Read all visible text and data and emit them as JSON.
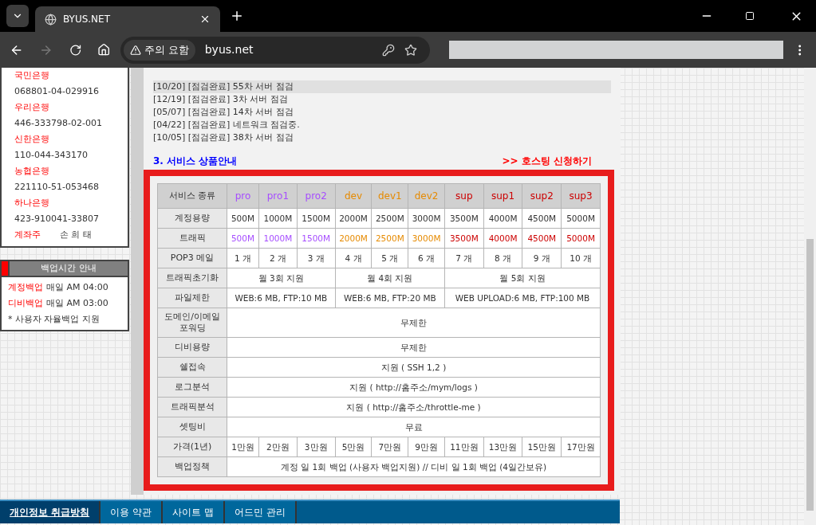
{
  "browser": {
    "tab_title": "BYUS.NET",
    "warning": "주의 요함",
    "url": "byus.net"
  },
  "sidebar": {
    "banks": [
      {
        "name": "국민은행",
        "account": "068801-04-029916"
      },
      {
        "name": "우리은행",
        "account": "446-333798-02-001"
      },
      {
        "name": "신한은행",
        "account": "110-044-343170"
      },
      {
        "name": "농협은행",
        "account": "221110-51-053468"
      },
      {
        "name": "하나은행",
        "account": "423-910041-33807"
      }
    ],
    "holder": {
      "label": "계좌주",
      "value": "손 희 태"
    },
    "backup": {
      "title": "백업시간 안내",
      "items": [
        {
          "label": "계정백업",
          "text": "매일 AM 04:00"
        },
        {
          "label": "디비백업",
          "text": "매일 AM 03:00"
        }
      ],
      "note": "* 사용자 자율백업 지원"
    }
  },
  "notices": [
    {
      "text": "[10/20] [점검완료] 55차 서버 점검",
      "selected": true
    },
    {
      "text": "[12/19] [점검완료] 3차 서버 점검",
      "selected": false
    },
    {
      "text": "[05/07] [점검완료] 14차 서버 점검",
      "selected": false
    },
    {
      "text": "[04/22] [점검완료] 네트워크 점검중.",
      "selected": false
    },
    {
      "text": "[10/05] [점검완료] 38차 서버 점검",
      "selected": false
    }
  ],
  "section": {
    "title": "3. 서비스 상품안내",
    "link": ">> 호스팅 신청하기"
  },
  "table": {
    "header": "서비스 종류",
    "plans": [
      {
        "name": "pro",
        "color": "#a64dff"
      },
      {
        "name": "pro1",
        "color": "#a64dff"
      },
      {
        "name": "pro2",
        "color": "#a64dff"
      },
      {
        "name": "dev",
        "color": "#e68a00"
      },
      {
        "name": "dev1",
        "color": "#e68a00"
      },
      {
        "name": "dev2",
        "color": "#e68a00"
      },
      {
        "name": "sup",
        "color": "#cc0000"
      },
      {
        "name": "sup1",
        "color": "#cc0000"
      },
      {
        "name": "sup2",
        "color": "#cc0000"
      },
      {
        "name": "sup3",
        "color": "#cc0000"
      }
    ],
    "rows": [
      {
        "label": "계정용량",
        "kind": "plain",
        "values": [
          "500M",
          "1000M",
          "1500M",
          "2000M",
          "2500M",
          "3000M",
          "3500M",
          "4000M",
          "4500M",
          "5000M"
        ]
      },
      {
        "label": "트래픽",
        "kind": "colored",
        "values": [
          "500M",
          "1000M",
          "1500M",
          "2000M",
          "2500M",
          "3000M",
          "3500M",
          "4000M",
          "4500M",
          "5000M"
        ]
      },
      {
        "label": "POP3 메일",
        "kind": "plain",
        "values": [
          "1 개",
          "2 개",
          "3 개",
          "4 개",
          "5 개",
          "6 개",
          "7 개",
          "8 개",
          "9 개",
          "10 개"
        ]
      },
      {
        "label": "트래픽초기화",
        "kind": "groups",
        "values": [
          "월 3회 지원",
          "월 4회 지원",
          "월 5회 지원"
        ]
      },
      {
        "label": "파일제한",
        "kind": "groups",
        "values": [
          "WEB:6 MB, FTP:10 MB",
          "WEB:6 MB, FTP:20 MB",
          "WEB UPLOAD:6 MB, FTP:100 MB"
        ]
      },
      {
        "label": "도메인/이메일 포워딩",
        "kind": "span",
        "values": [
          "무제한"
        ]
      },
      {
        "label": "디비용량",
        "kind": "span",
        "values": [
          "무제한"
        ]
      },
      {
        "label": "쉘접속",
        "kind": "span",
        "values": [
          "지원 ( SSH 1,2 )"
        ]
      },
      {
        "label": "로그분석",
        "kind": "span",
        "values": [
          "지원 ( http://홈주소/mym/logs )"
        ]
      },
      {
        "label": "트래픽분석",
        "kind": "span",
        "values": [
          "지원 ( http://홈주소/throttle-me )"
        ]
      },
      {
        "label": "셋팅비",
        "kind": "span",
        "values": [
          "무료"
        ]
      },
      {
        "label": "가격(1년)",
        "kind": "plain",
        "values": [
          "1만원",
          "2만원",
          "3만원",
          "5만원",
          "7만원",
          "9만원",
          "11만원",
          "13만원",
          "15만원",
          "17만원"
        ]
      },
      {
        "label": "백업정책",
        "kind": "span",
        "values": [
          "계정 일 1회 백업 (사용자 백업지원) // 디비 일 1회 백업 (4일간보유)"
        ]
      }
    ]
  },
  "footer": [
    {
      "label": "개인정보 취급방침",
      "selected": true
    },
    {
      "label": "이용 약관",
      "selected": false
    },
    {
      "label": "사이트 맵",
      "selected": false
    },
    {
      "label": "어드민 관리",
      "selected": false
    }
  ]
}
